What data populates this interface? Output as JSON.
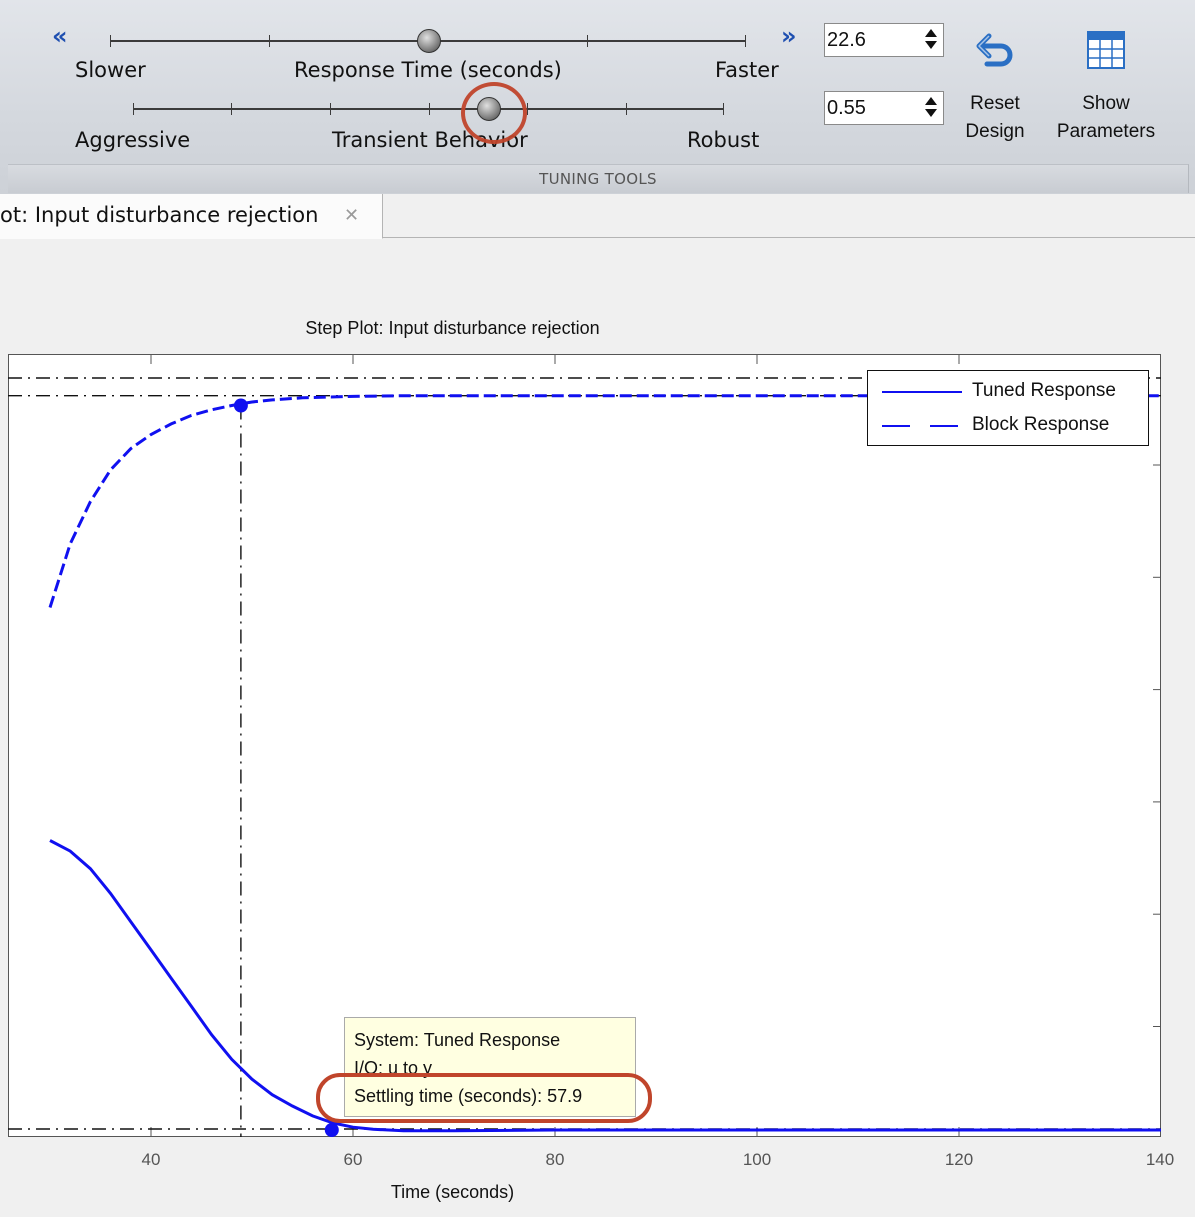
{
  "toolstrip": {
    "response_time": {
      "left_label": "Slower",
      "center_label": "Response Time (seconds)",
      "right_label": "Faster",
      "value": "22.6",
      "knob_fraction": 0.5
    },
    "transient_behavior": {
      "left_label": "Aggressive",
      "center_label": "Transient Behavior",
      "right_label": "Robust",
      "value": "0.55",
      "knob_fraction": 0.6
    },
    "reset_design_line1": "Reset",
    "reset_design_line2": "Design",
    "show_parameters_line1": "Show",
    "show_parameters_line2": "Parameters",
    "section_label": "TUNING TOOLS",
    "decrease_icon": "double-chevron-left-icon",
    "increase_icon": "double-chevron-right-icon"
  },
  "tab": {
    "label": "ot: Input disturbance rejection",
    "close_glyph": "✕"
  },
  "plot": {
    "title": "Step Plot: Input disturbance rejection",
    "xlabel": "Time (seconds)",
    "legend": [
      "Tuned Response",
      "Block Response"
    ],
    "tooltip": {
      "system": "System: Tuned Response",
      "io": "I/O: u to y",
      "settling": "Settling time (seconds): 57.9"
    }
  },
  "chart_data": {
    "type": "line",
    "title": "Step Plot: Input disturbance rejection",
    "xlabel": "Time (seconds)",
    "ylabel": "",
    "xlim": [
      30,
      140
    ],
    "x_ticks": [
      40,
      60,
      80,
      100,
      120,
      140
    ],
    "grid": false,
    "legend_position": "top-right",
    "series": [
      {
        "name": "Tuned Response",
        "style": "solid",
        "color": "#1010f0",
        "x": [
          30,
          32,
          34,
          36,
          38,
          40,
          42,
          44,
          46,
          48,
          50,
          52,
          54,
          56,
          58,
          60,
          62,
          65,
          70,
          80,
          90,
          100,
          110,
          120,
          130,
          140
        ],
        "y": [
          0.41,
          0.395,
          0.37,
          0.335,
          0.295,
          0.255,
          0.215,
          0.175,
          0.135,
          0.1,
          0.072,
          0.05,
          0.034,
          0.02,
          0.01,
          0.004,
          0.001,
          -0.001,
          -0.001,
          0.0,
          0.0,
          0.0,
          0.0,
          0.0,
          0.0,
          0.0
        ]
      },
      {
        "name": "Block Response",
        "style": "dashed",
        "color": "#1010f0",
        "x": [
          30,
          32,
          34,
          36,
          38,
          40,
          42,
          44,
          46,
          48,
          50,
          52,
          55,
          60,
          65,
          70,
          80,
          90,
          100,
          120,
          140
        ],
        "y": [
          0.74,
          0.83,
          0.89,
          0.935,
          0.965,
          0.985,
          1.0,
          1.012,
          1.02,
          1.026,
          1.031,
          1.034,
          1.037,
          1.039,
          1.04,
          1.04,
          1.04,
          1.04,
          1.04,
          1.04,
          1.04
        ]
      }
    ],
    "settling_markers": [
      {
        "series": "Tuned Response",
        "x": 57.9,
        "y": 0.0
      },
      {
        "series": "Block Response",
        "x": 48.9,
        "y": 1.026
      }
    ],
    "reference_lines": {
      "tuned_settling_time": 57.9,
      "block_settling_time": 48.9,
      "upper_band": [
        1.04,
        1.065
      ],
      "lower_band": [
        0.0
      ]
    }
  }
}
